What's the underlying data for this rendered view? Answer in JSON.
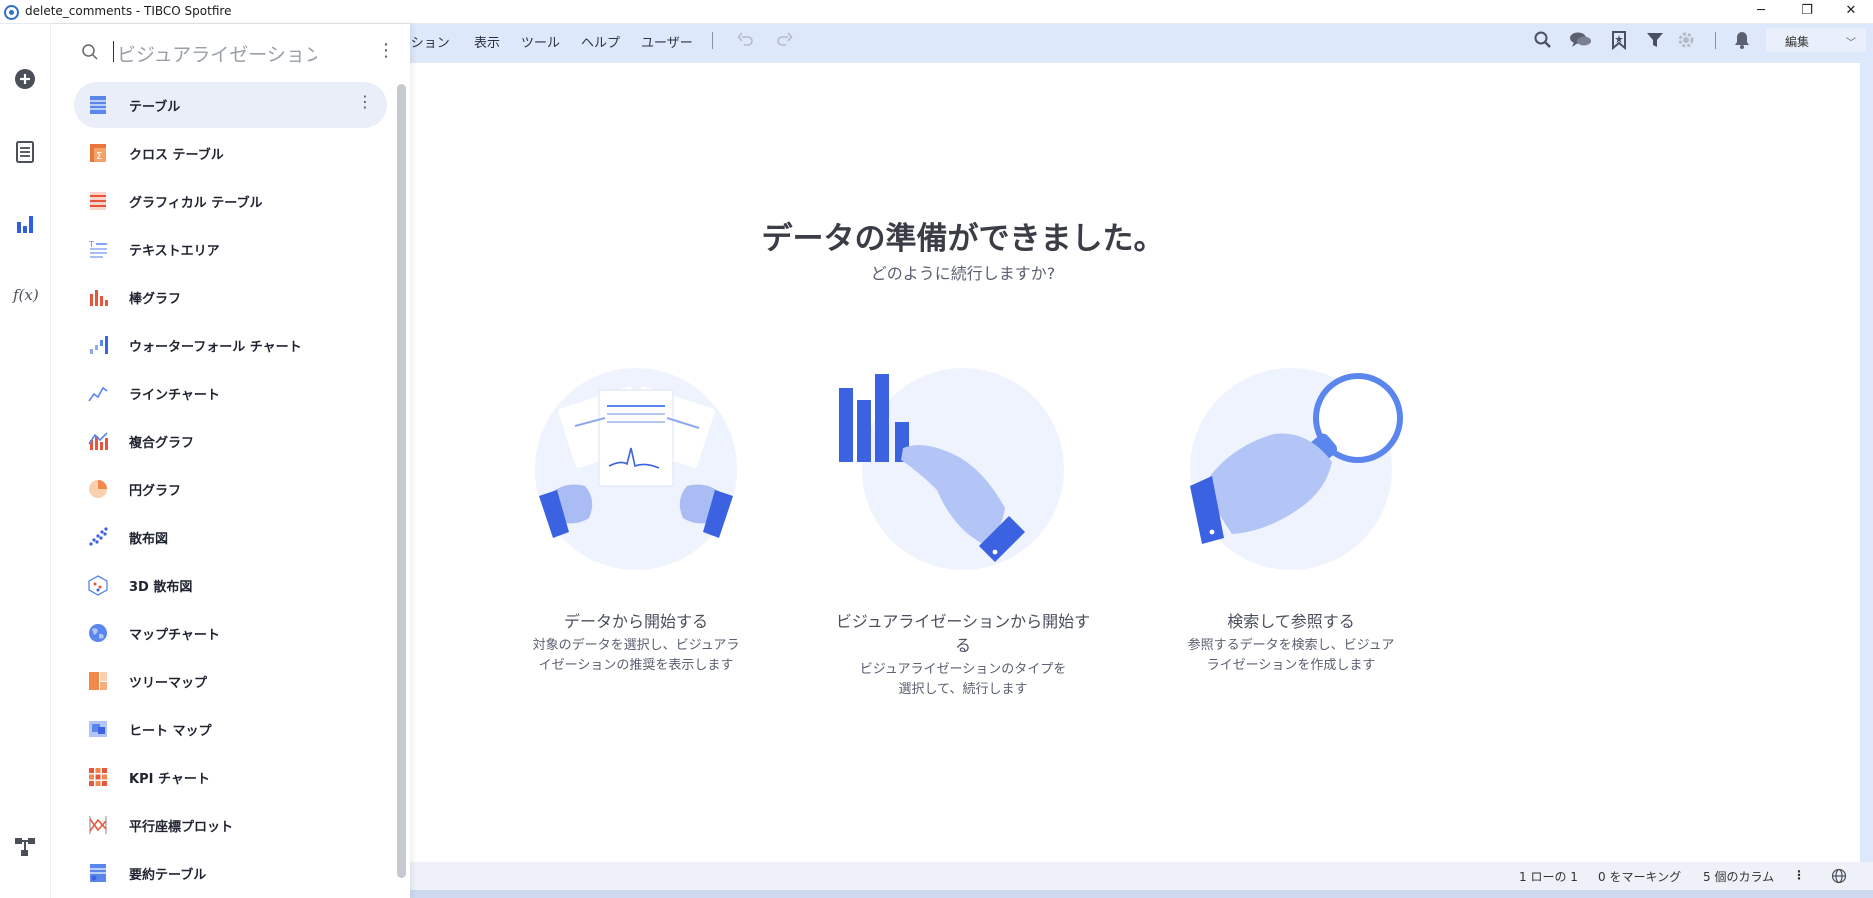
{
  "window": {
    "title": "delete_comments - TIBCO Spotfire",
    "minimize": "─",
    "restore": "❐",
    "close": "✕"
  },
  "menubar": {
    "items": [
      "ーション",
      "表示",
      "ツール",
      "ヘルプ",
      "ユーザー"
    ],
    "mode_select": "編集"
  },
  "search": {
    "placeholder": "ビジュアライゼーションを検索"
  },
  "visualizations": [
    {
      "label": "テーブル",
      "icon": "table-icon"
    },
    {
      "label": "クロス テーブル",
      "icon": "cross-table-icon"
    },
    {
      "label": "グラフィカル テーブル",
      "icon": "graphical-table-icon"
    },
    {
      "label": "テキストエリア",
      "icon": "text-area-icon"
    },
    {
      "label": "棒グラフ",
      "icon": "bar-chart-icon"
    },
    {
      "label": "ウォーターフォール チャート",
      "icon": "waterfall-chart-icon"
    },
    {
      "label": "ラインチャート",
      "icon": "line-chart-icon"
    },
    {
      "label": "複合グラフ",
      "icon": "combination-chart-icon"
    },
    {
      "label": "円グラフ",
      "icon": "pie-chart-icon"
    },
    {
      "label": "散布図",
      "icon": "scatter-plot-icon"
    },
    {
      "label": "3D 散布図",
      "icon": "3d-scatter-plot-icon"
    },
    {
      "label": "マップチャート",
      "icon": "map-chart-icon"
    },
    {
      "label": "ツリーマップ",
      "icon": "treemap-icon"
    },
    {
      "label": "ヒート マップ",
      "icon": "heat-map-icon"
    },
    {
      "label": "KPI チャート",
      "icon": "kpi-chart-icon"
    },
    {
      "label": "平行座標プロット",
      "icon": "parallel-coordinate-plot-icon"
    },
    {
      "label": "要約テーブル",
      "icon": "summary-table-icon"
    }
  ],
  "main": {
    "title": "データの準備ができました。",
    "subtitle": "どのように続行しますか?",
    "cards": [
      {
        "title": "データから開始する",
        "desc_line1": "対象のデータを選択し、ビジュアラ",
        "desc_line2": "イゼーションの推奨を表示します"
      },
      {
        "title": "ビジュアライゼーションから開始する",
        "desc_line1": "ビジュアライゼーションのタイプを",
        "desc_line2": "選択して、続行します"
      },
      {
        "title": "検索して参照する",
        "desc_line1": "参照するデータを検索し、ビジュア",
        "desc_line2": "ライゼーションを作成します"
      }
    ]
  },
  "statusbar": {
    "rows": "1 ローの 1",
    "marked": "0 をマーキング",
    "columns": "5 個のカラム"
  },
  "colors": {
    "accent": "#2f5fe0",
    "menubar": "#dde8fa",
    "selected_item": "#e9eef8"
  }
}
